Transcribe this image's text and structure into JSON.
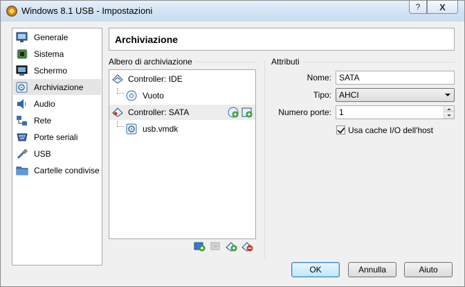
{
  "window": {
    "title": "Windows 8.1 USB - Impostazioni",
    "help_label": "?",
    "close_label": "X"
  },
  "sidebar": {
    "items": [
      {
        "label": "Generale",
        "icon": "monitor-icon"
      },
      {
        "label": "Sistema",
        "icon": "chip-icon"
      },
      {
        "label": "Schermo",
        "icon": "display-icon"
      },
      {
        "label": "Archiviazione",
        "icon": "storage-icon",
        "selected": true
      },
      {
        "label": "Audio",
        "icon": "speaker-icon"
      },
      {
        "label": "Rete",
        "icon": "network-icon"
      },
      {
        "label": "Porte seriali",
        "icon": "serial-port-icon"
      },
      {
        "label": "USB",
        "icon": "usb-icon"
      },
      {
        "label": "Cartelle condivise",
        "icon": "folder-icon"
      }
    ]
  },
  "page": {
    "title": "Archiviazione"
  },
  "storage_tree": {
    "group_label": "Albero di archiviazione",
    "items": [
      {
        "label": "Controller: IDE",
        "icon": "ide-controller-icon"
      },
      {
        "label": "Vuoto",
        "icon": "optical-disc-icon"
      },
      {
        "label": "Controller: SATA",
        "icon": "sata-controller-icon",
        "selected": true
      },
      {
        "label": "usb.vmdk",
        "icon": "hard-disk-icon"
      }
    ]
  },
  "attributes": {
    "group_label": "Attributi",
    "name_label": "Nome:",
    "name_value": "SATA",
    "type_label": "Tipo:",
    "type_value": "AHCI",
    "ports_label": "Numero porte:",
    "ports_value": "1",
    "host_cache_label": "Usa cache I/O dell'host",
    "host_cache_checked": true
  },
  "buttons": {
    "ok": "OK",
    "cancel": "Annulla",
    "help": "Aiuto"
  },
  "colors": {
    "selection": "#e5e5e5",
    "default_button": "#bee6fd",
    "add_icon": "#2e9a2e"
  }
}
